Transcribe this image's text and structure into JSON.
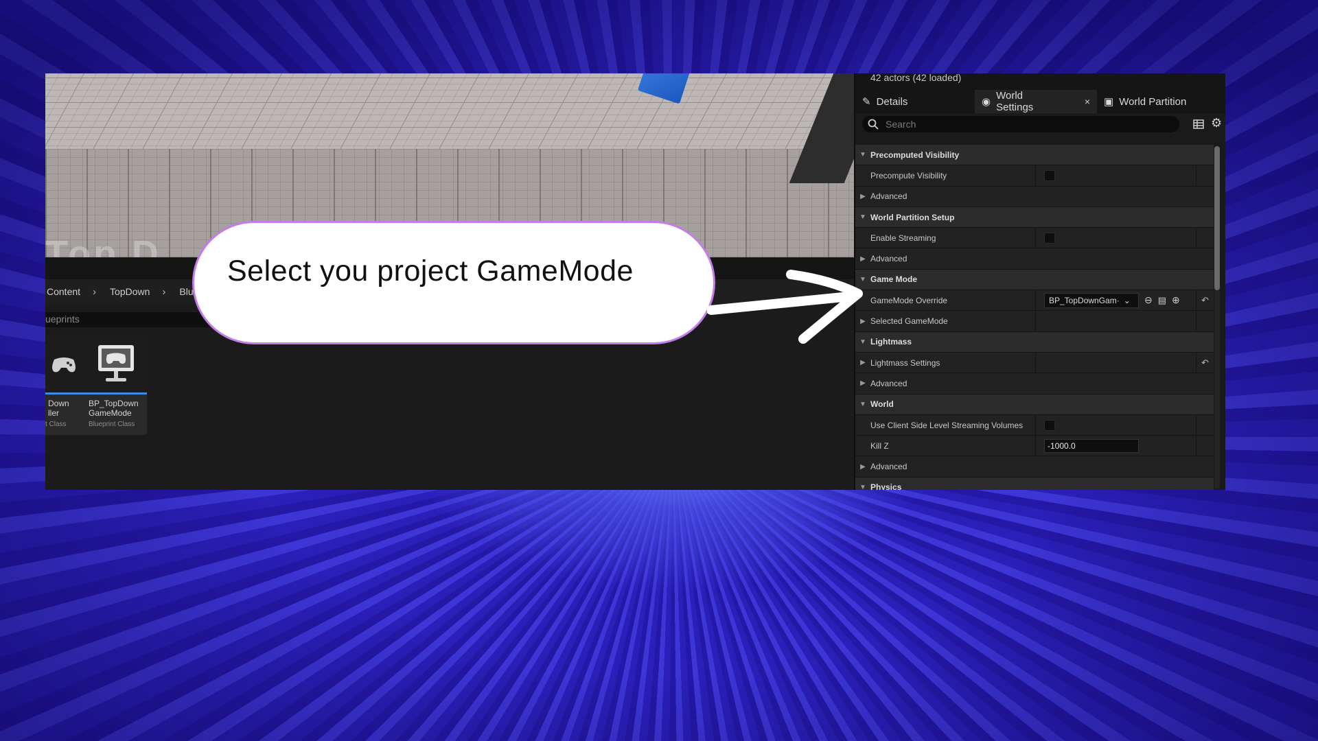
{
  "callout": {
    "text": "Select you project GameMode"
  },
  "viewport": {
    "overlay_text": "Top D"
  },
  "content_browser": {
    "breadcrumb": [
      "Content",
      "TopDown",
      "Blue"
    ],
    "search_text": "ueprints",
    "assets": [
      {
        "name_line1": "Down",
        "name_line2": "ller",
        "type": "t Class"
      },
      {
        "name_line1": "BP_TopDown",
        "name_line2": "GameMode",
        "type": "Blueprint Class"
      }
    ]
  },
  "panel": {
    "actors_label": "42 actors (42 loaded)",
    "tabs": {
      "details": "Details",
      "world_settings": "World Settings",
      "close": "×",
      "world_partition": "World Partition"
    },
    "search_placeholder": "Search",
    "rows": {
      "precomputed_visibility": "Precomputed Visibility",
      "precompute_visibility": "Precompute Visibility",
      "advanced_1": "Advanced",
      "world_partition_setup": "World Partition Setup",
      "enable_streaming": "Enable Streaming",
      "advanced_2": "Advanced",
      "game_mode": "Game Mode",
      "gamemode_override": "GameMode Override",
      "gamemode_override_value": "BP_TopDownGam·",
      "selected_gamemode": "Selected GameMode",
      "lightmass": "Lightmass",
      "lightmass_settings": "Lightmass Settings",
      "advanced_3": "Advanced",
      "world": "World",
      "client_streaming": "Use Client Side Level Streaming Volumes",
      "kill_z": "Kill Z",
      "kill_z_value": "-1000.0",
      "advanced_4": "Advanced",
      "physics": "Physics"
    }
  },
  "colors": {
    "callout_border": "#c37ce8",
    "asset_underline": "#3c8be8",
    "background_blue": "#2a1fb0"
  }
}
